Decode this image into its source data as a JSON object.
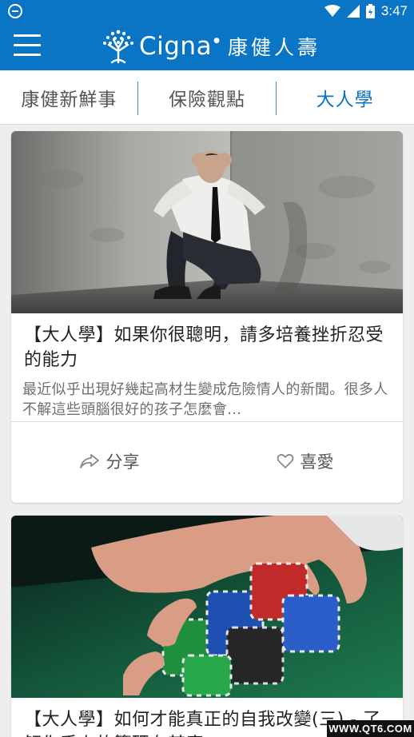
{
  "status_bar": {
    "time": "3:47",
    "icons": [
      "notification-icon",
      "wifi-icon",
      "signal-icon",
      "battery-icon"
    ]
  },
  "app_bar": {
    "brand_name": "Cigna",
    "brand_cn": "康健人壽",
    "accent_color": "#0a74c5",
    "icons": [
      "menu-icon",
      "tree-logo-icon"
    ]
  },
  "tabs": [
    {
      "label": "康健新鮮事",
      "active": false
    },
    {
      "label": "保險觀點",
      "active": false
    },
    {
      "label": "大人學",
      "active": true
    }
  ],
  "articles": [
    {
      "title": "【大人學】如果你很聰明，請多培養挫折忍受的能力",
      "description": "最近似乎出現好幾起高材生變成危險情人的新聞。很多人不解這些頭腦很好的孩子怎麼會...",
      "share_label": "分享",
      "like_label": "喜愛"
    },
    {
      "title": "【大人學】如何才能真正的自我改變(三) - 了解你手上的籌碼有甚麼"
    }
  ],
  "watermark": "WWW.QT6.COM"
}
